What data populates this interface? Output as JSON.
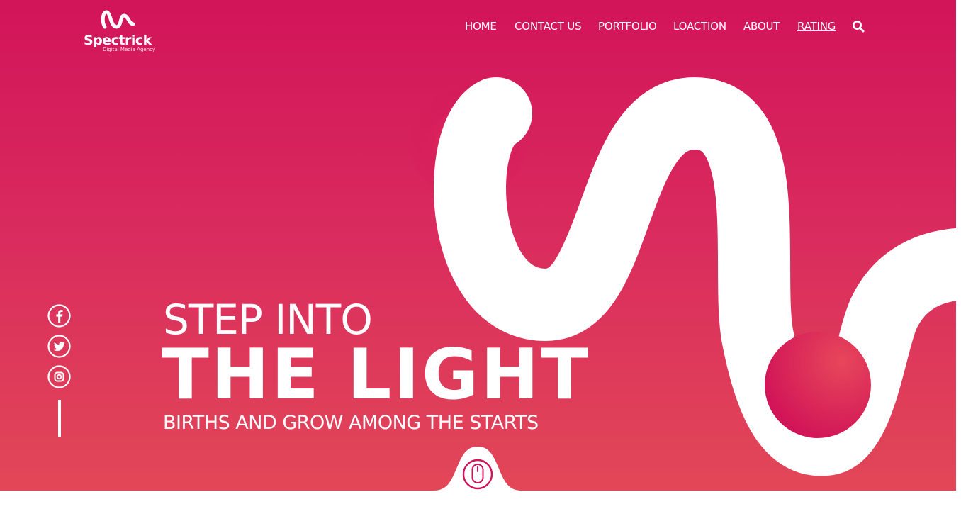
{
  "brand": {
    "name": "Spectrick",
    "tagline": "Digital Media Agency",
    "logo_icon": "wave-logo-icon"
  },
  "nav": {
    "items": [
      {
        "label": "HOME",
        "active": false
      },
      {
        "label": "CONTACT US",
        "active": false
      },
      {
        "label": "PORTFOLIO",
        "active": false
      },
      {
        "label": "LOACTION",
        "active": false
      },
      {
        "label": "ABOUT",
        "active": false
      },
      {
        "label": "RATING",
        "active": true
      }
    ],
    "search_icon": "search-icon"
  },
  "social": {
    "icons": [
      "facebook-icon",
      "twitter-icon",
      "instagram-icon"
    ]
  },
  "hero": {
    "line1": "STEP INTO",
    "line2": "THE LIGHT",
    "line3": "BIRTHS AND GROW AMONG THE STARTS",
    "scroll_icon": "mouse-scroll-icon"
  },
  "colors": {
    "gradient_top": "#d21459",
    "gradient_bottom": "#e24757",
    "accent": "#d0135a",
    "text": "#ffffff"
  }
}
